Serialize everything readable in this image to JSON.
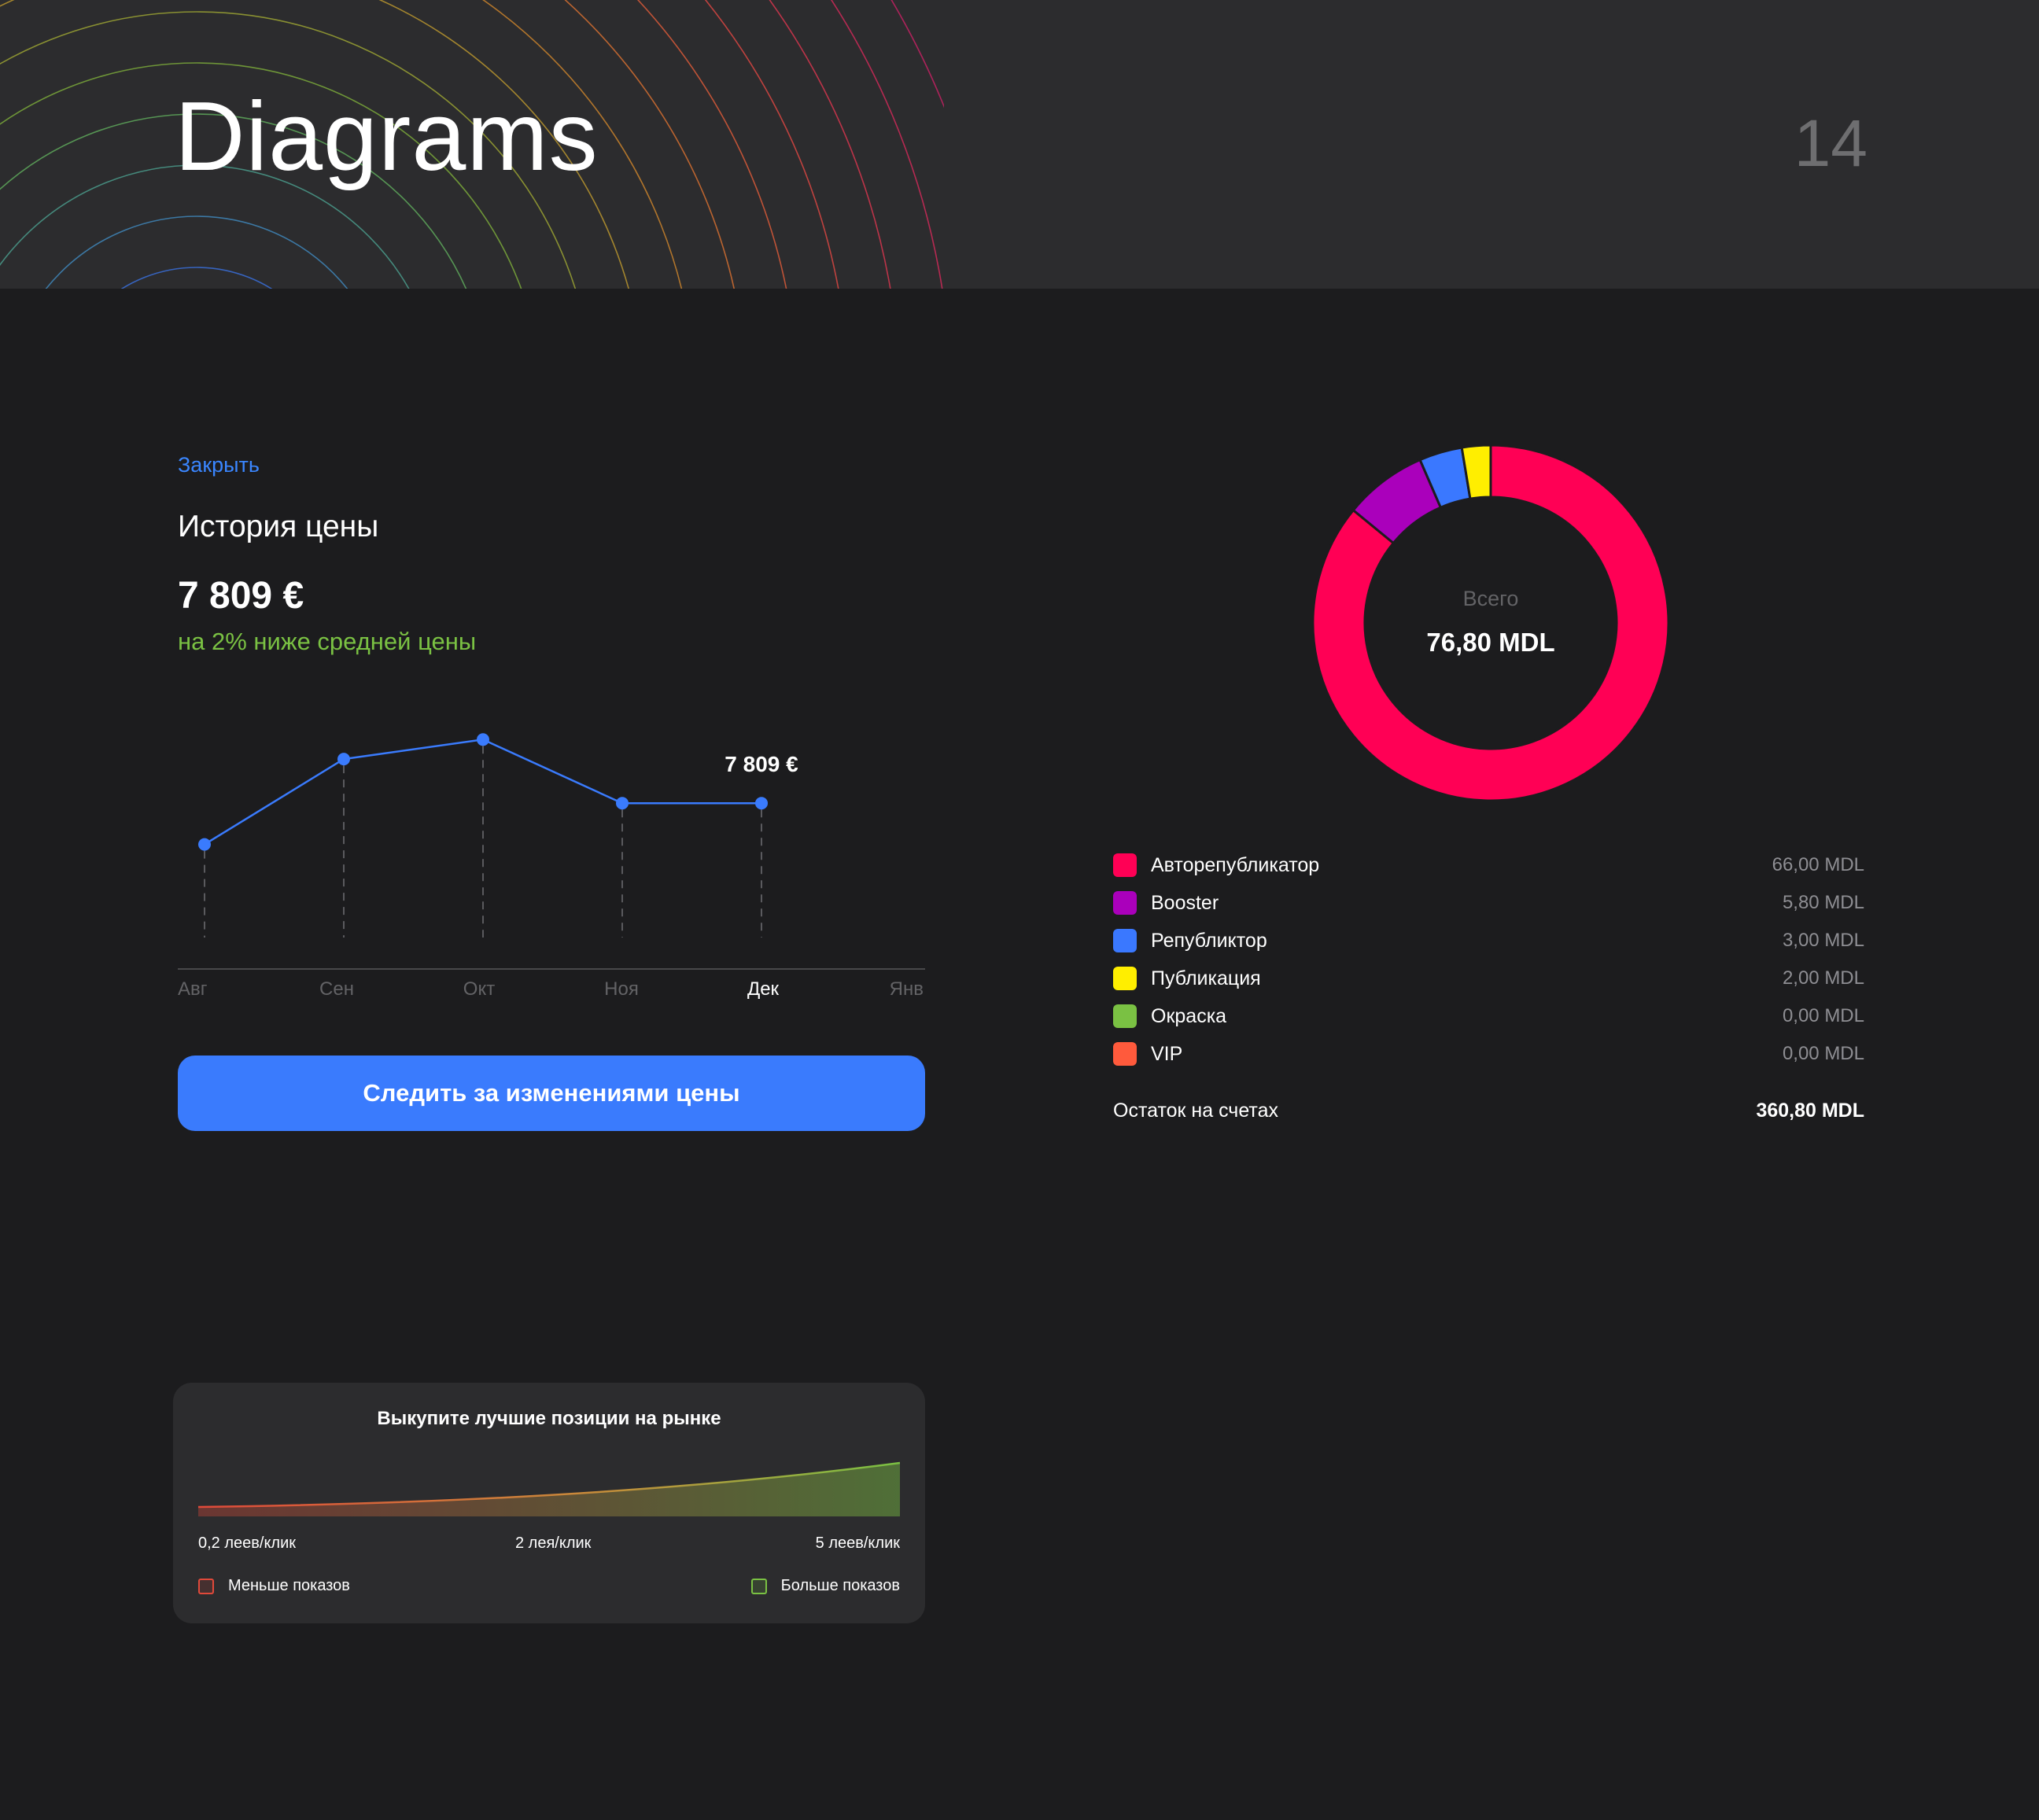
{
  "header": {
    "title": "Diagrams",
    "page_number": "14"
  },
  "price_card": {
    "close_label": "Закрыть",
    "heading": "История цены",
    "price": "7 809 €",
    "note": "на 2% ниже средней цены",
    "button_label": "Следить за изменениями цены",
    "accent_color": "#3a7bfd",
    "note_color": "#7ac143"
  },
  "chart_data": [
    {
      "type": "line",
      "title": "",
      "categories": [
        "Авг",
        "Сен",
        "Окт",
        "Ноя",
        "Дек",
        "Янв"
      ],
      "highlighted_category": "Дек",
      "series": [
        {
          "values": [
            7640,
            7990,
            8070,
            7809,
            7809
          ]
        }
      ],
      "data_label": "7 809 €",
      "data_label_index": 4,
      "ylim": [
        7200,
        8200
      ],
      "grid": false
    },
    {
      "type": "pie",
      "variant": "donut",
      "center_label": "Всего",
      "center_value": "76,80 MDL",
      "slices": [
        {
          "name": "Авторепубликатор",
          "value": 66.0,
          "display": "66,00 MDL",
          "color": "#ff0055"
        },
        {
          "name": "Booster",
          "value": 5.8,
          "display": "5,80 MDL",
          "color": "#aa00bb"
        },
        {
          "name": "Републиктор",
          "value": 3.0,
          "display": "3,00 MDL",
          "color": "#3a78ff"
        },
        {
          "name": "Публикация",
          "value": 2.0,
          "display": "2,00 MDL",
          "color": "#ffee00"
        },
        {
          "name": "Окраска",
          "value": 0.0,
          "display": "0,00 MDL",
          "color": "#7ac143"
        },
        {
          "name": "VIP",
          "value": 0.0,
          "display": "0,00 MDL",
          "color": "#ff5a3c"
        }
      ]
    },
    {
      "type": "area",
      "title": "Выкупите лучшие позиции на рынке",
      "x_tick_labels": [
        "0,2 леев/клик",
        "2 лея/клик",
        "5 леев/клик"
      ],
      "legend": [
        {
          "name": "Меньше показов",
          "color": "#e0493a"
        },
        {
          "name": "Больше показов",
          "color": "#7ac143"
        }
      ]
    }
  ],
  "balance": {
    "label": "Остаток на счетах",
    "value": "360,80 MDL"
  }
}
